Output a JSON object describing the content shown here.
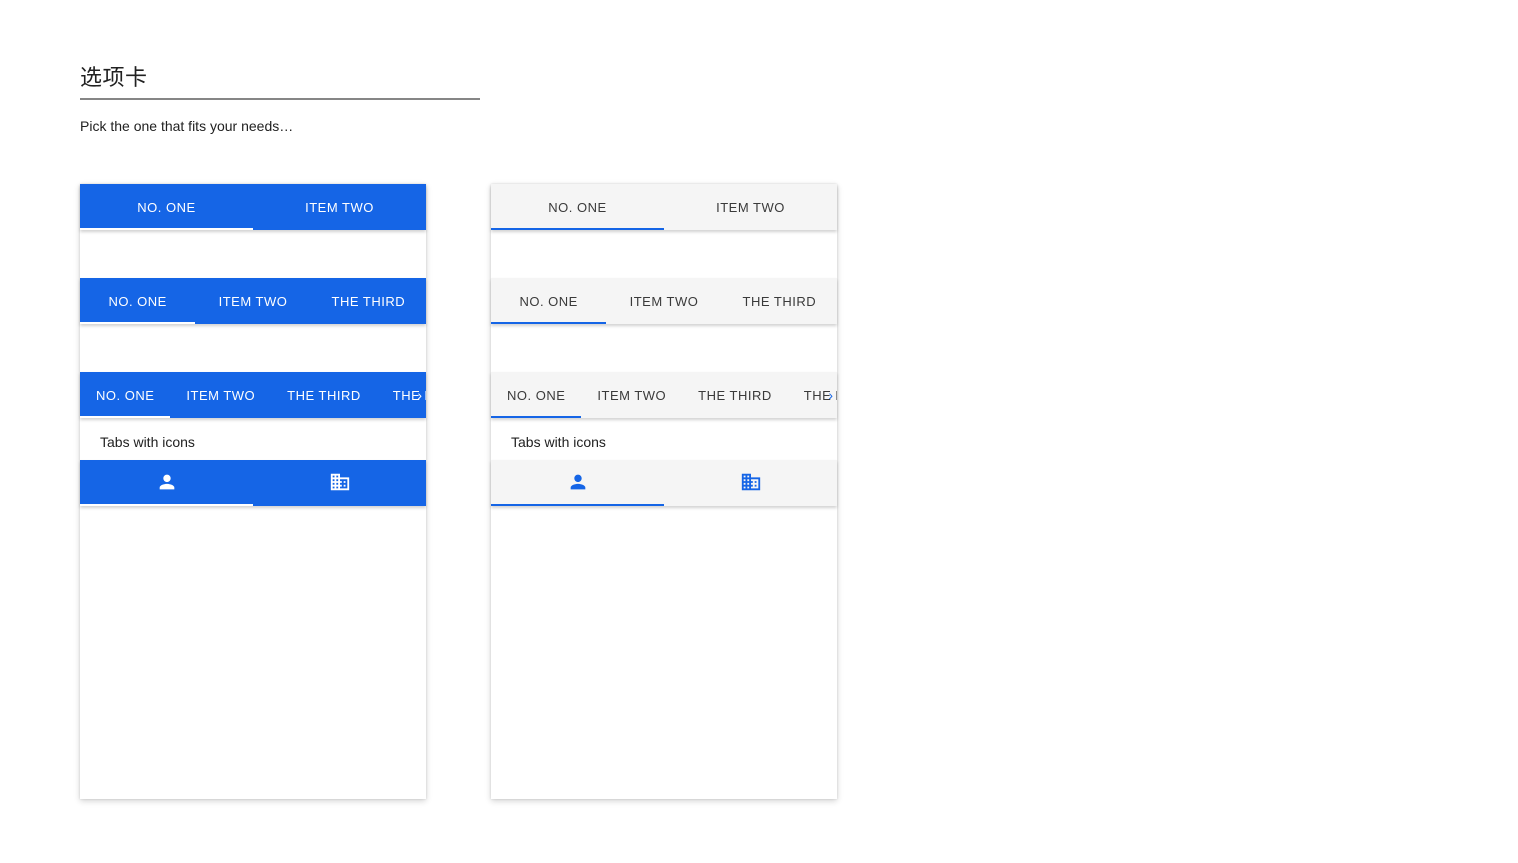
{
  "title": "选项卡",
  "intro": "Pick the one that fits your needs…",
  "tabs2": [
    "NO. ONE",
    "ITEM TWO"
  ],
  "tabs3": [
    "NO. ONE",
    "ITEM TWO",
    "THE THIRD"
  ],
  "tabs4": [
    "NO. ONE",
    "ITEM TWO",
    "THE THIRD",
    "THE FOURTH"
  ],
  "tabs4_truncated": "THE F",
  "icons_label": "Tabs with icons"
}
